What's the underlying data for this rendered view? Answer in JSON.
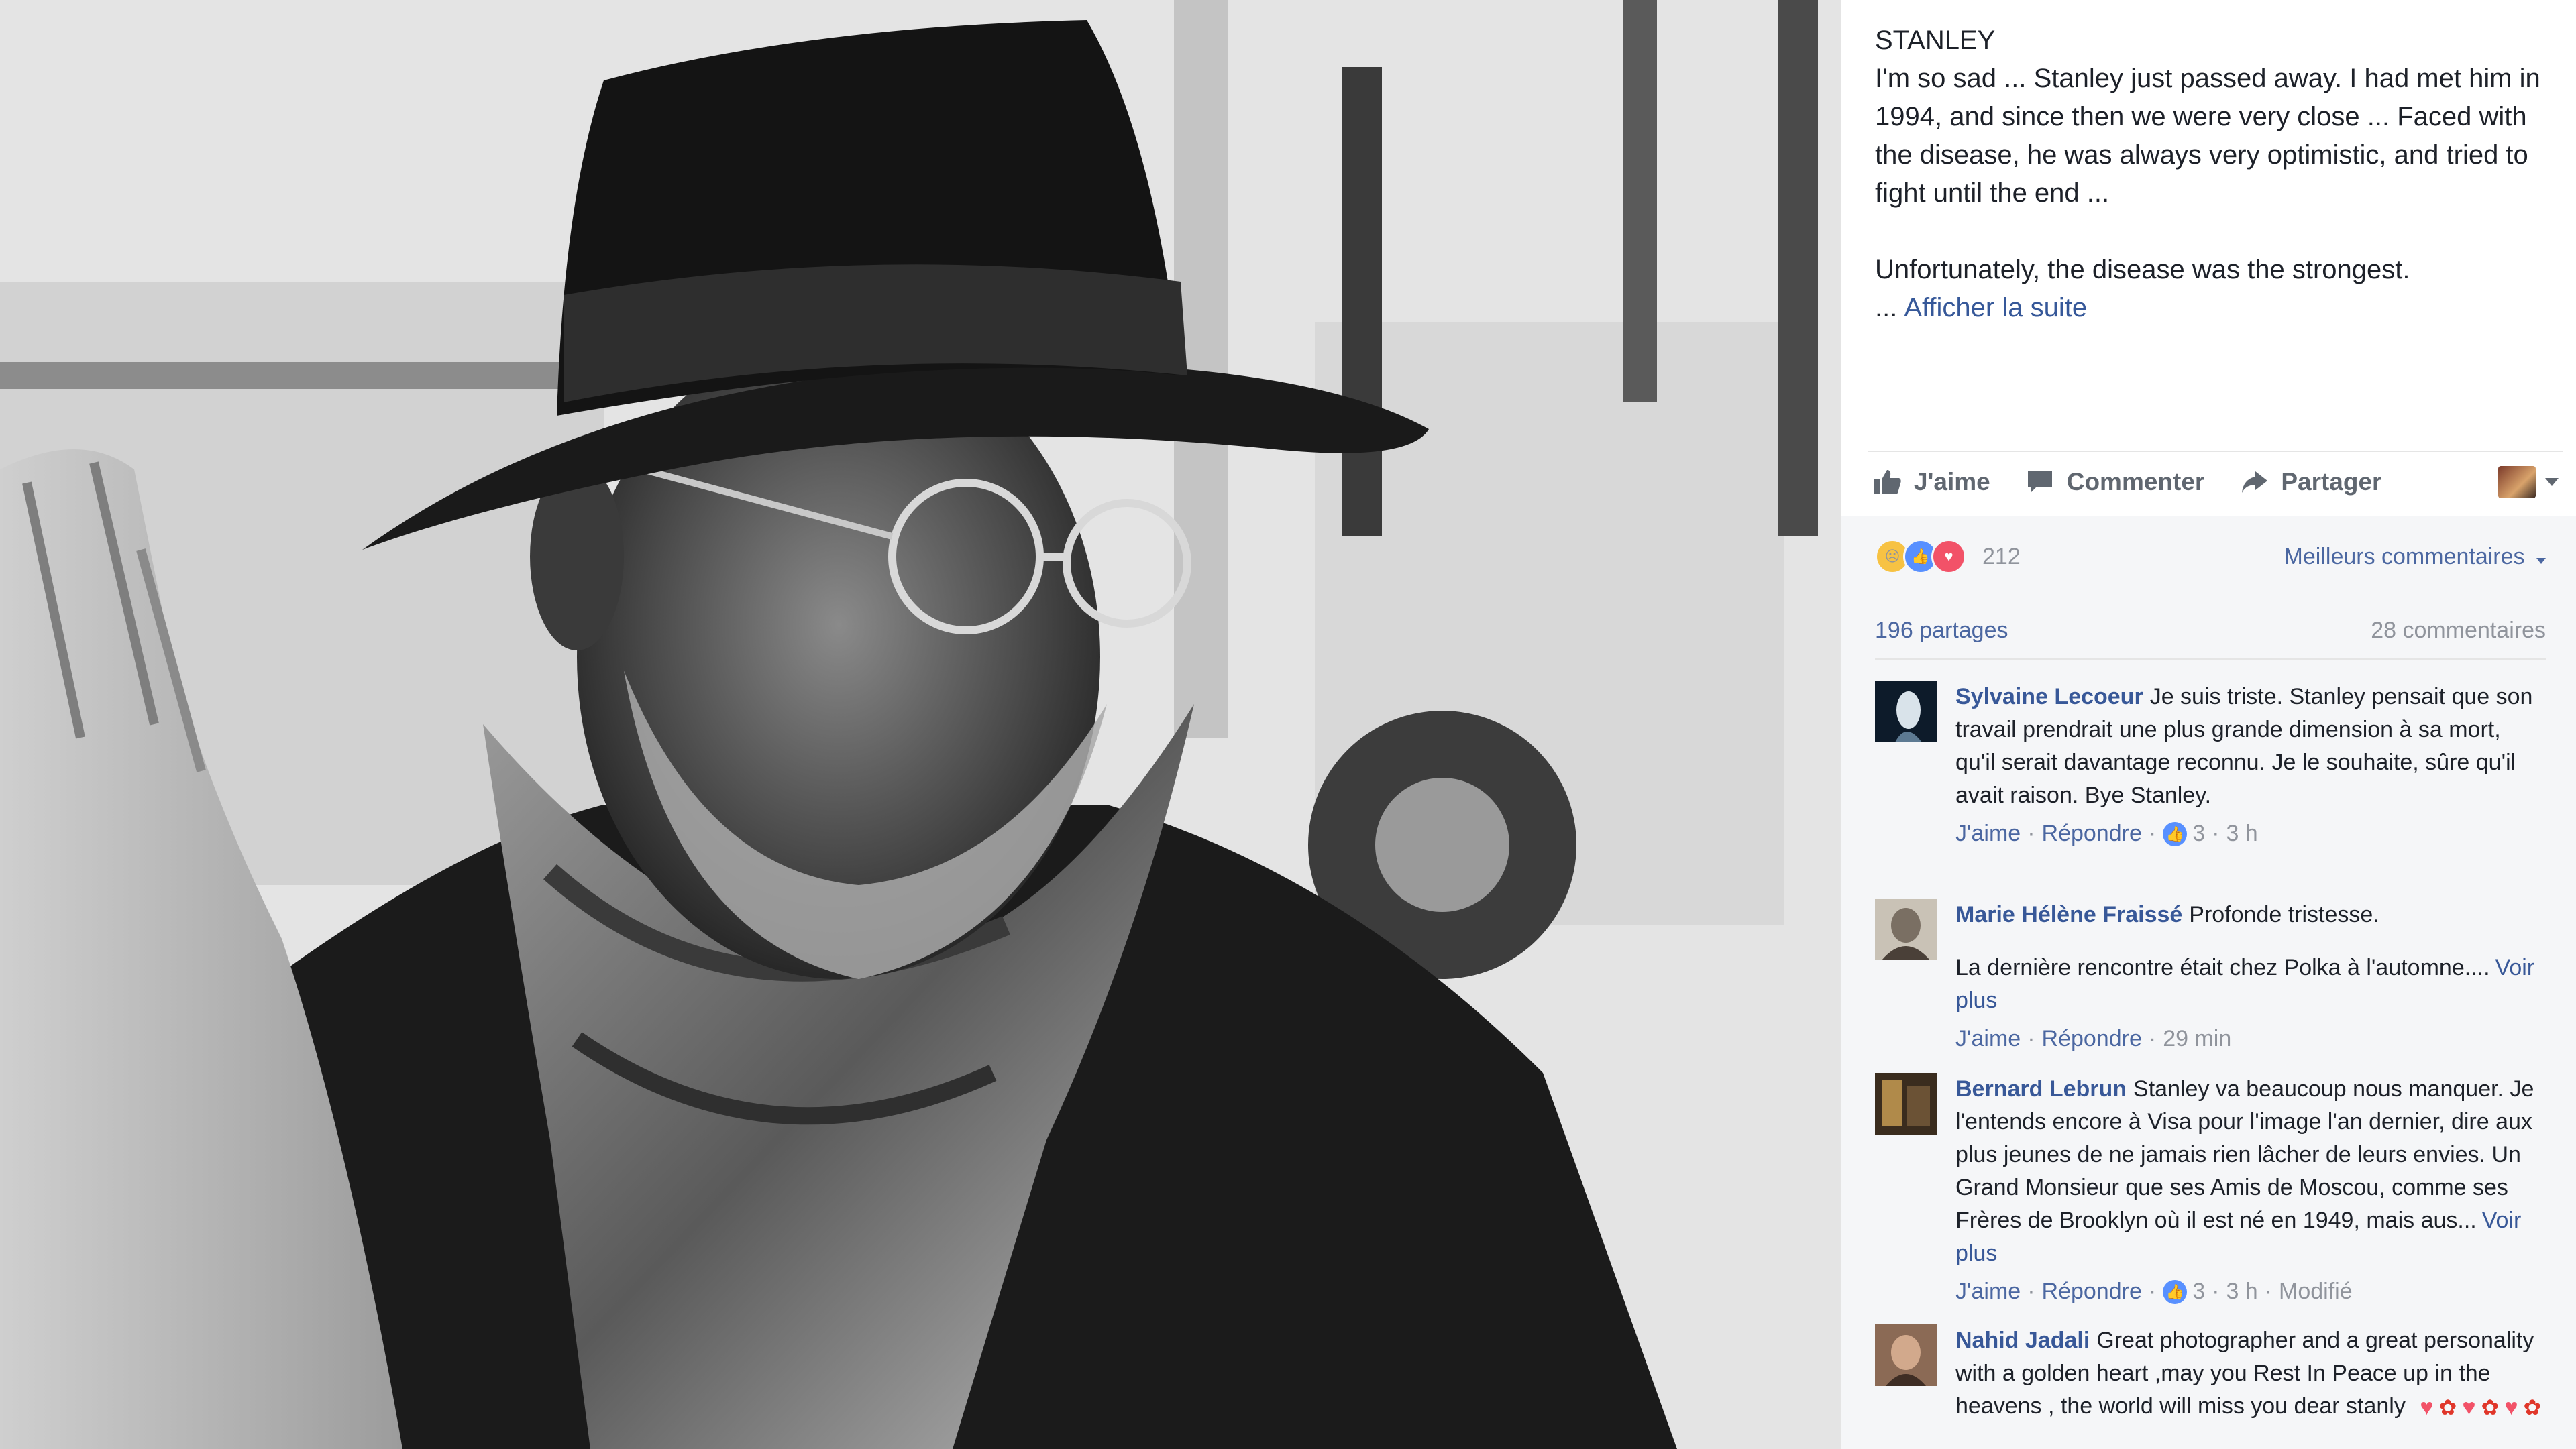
{
  "post": {
    "title": "STANLEY",
    "body": "I'm so sad ... Stanley just passed away. I had met him in 1994, and since then we were very close ... Faced with the disease, he was always very optimistic, and tried to fight until the end ...",
    "body2": "Unfortunately, the disease was the strongest.",
    "ellipsis": "...",
    "see_more": "Afficher la suite"
  },
  "actions": {
    "like": "J'aime",
    "comment": "Commenter",
    "share": "Partager",
    "like_icon": "thumbs-up-icon",
    "comment_icon": "speech-bubble-icon",
    "share_icon": "share-arrow-icon"
  },
  "stats": {
    "reaction_count": "212",
    "sort_label": "Meilleurs commentaires",
    "shares": "196 partages",
    "comments": "28 commentaires"
  },
  "comments": [
    {
      "author": "Sylvaine Lecoeur",
      "text": "Je suis triste. Stanley pensait que son travail prendrait une plus grande dimension à sa mort, qu'il serait davantage reconnu. Je le souhaite, sûre qu'il avait raison. Bye Stanley.",
      "like": "J'aime",
      "reply": "Répondre",
      "likes": "3",
      "time": "3 h"
    },
    {
      "author": "Marie Hélène Fraissé",
      "text": "Profonde tristesse.",
      "text2": "La dernière rencontre était chez Polka à l'automne....",
      "more": "Voir plus",
      "like": "J'aime",
      "reply": "Répondre",
      "time": "29 min"
    },
    {
      "author": "Bernard Lebrun",
      "text": "Stanley va beaucoup nous manquer. Je l'entends encore à Visa pour l'image l'an dernier, dire aux plus jeunes de ne jamais rien lâcher de leurs envies. Un Grand Monsieur que ses Amis de Moscou, comme ses Frères de Brooklyn où il est né en 1949, mais aus...",
      "more": "Voir plus",
      "like": "J'aime",
      "reply": "Répondre",
      "likes": "3",
      "time": "3 h",
      "edited": "Modifié"
    },
    {
      "author": "Nahid Jadali",
      "text": "Great photographer and a great personality with a golden heart ,may you Rest In Peace up in the heavens , the world will miss you dear stanly"
    }
  ],
  "colors": {
    "link": "#385898",
    "meta": "#90949c",
    "like_blue": "#5890ff",
    "love_red": "#f25268"
  }
}
